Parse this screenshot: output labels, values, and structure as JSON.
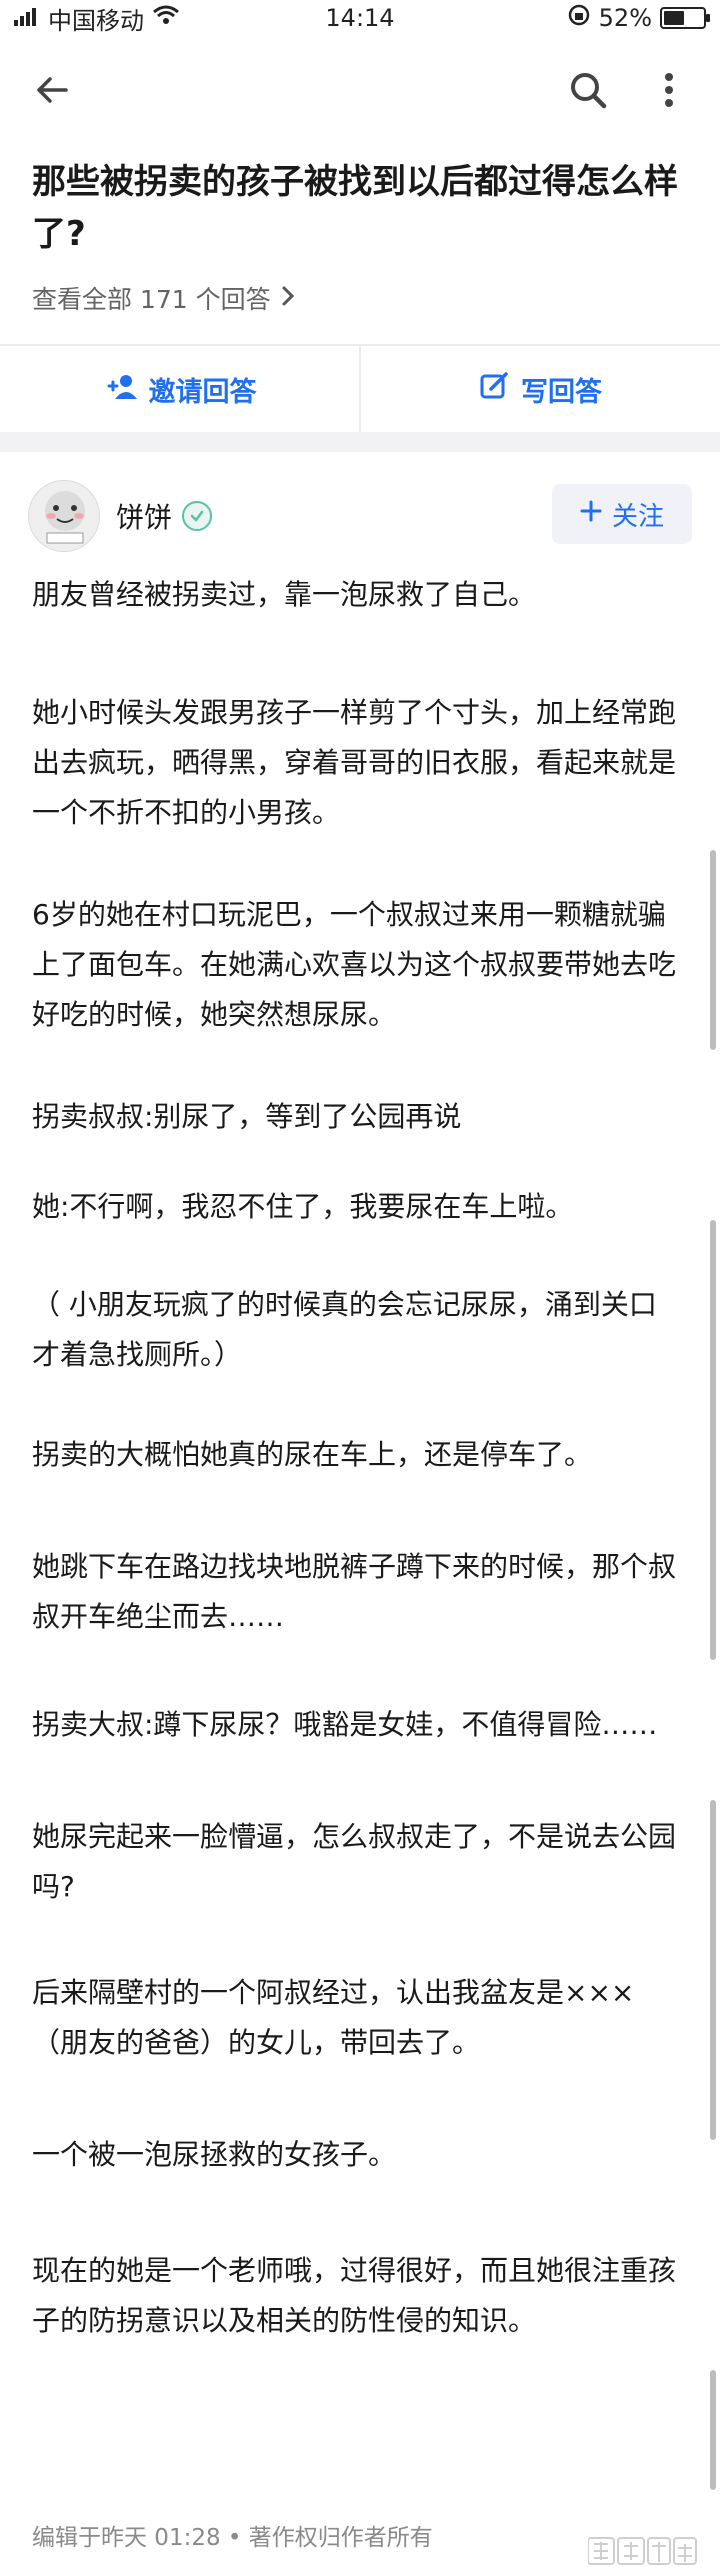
{
  "status_bar": {
    "carrier": "中国移动",
    "time": "14:14",
    "battery": "52%",
    "battery_level": 0.52
  },
  "question": {
    "title": "那些被拐卖的孩子被找到以后都过得怎么样了?",
    "all_answers": "查看全部 171 个回答"
  },
  "actions": {
    "invite": "邀请回答",
    "write": "写回答"
  },
  "author": {
    "name": "饼饼",
    "follow": "关注"
  },
  "answer": {
    "paragraphs": [
      "朋友曾经被拐卖过，靠一泡尿救了自己。",
      "她小时候头发跟男孩子一样剪了个寸头，加上经常跑出去疯玩，晒得黑，穿着哥哥的旧衣服，看起来就是一个不折不扣的小男孩。",
      "6岁的她在村口玩泥巴，一个叔叔过来用一颗糖就骗上了面包车。在她满心欢喜以为这个叔叔要带她去吃好吃的时候，她突然想尿尿。",
      "拐卖叔叔:别尿了，等到了公园再说",
      "她:不行啊，我忍不住了，我要尿在车上啦。",
      "（ 小朋友玩疯了的时候真的会忘记尿尿，涌到关口才着急找厕所。）",
      "拐卖的大概怕她真的尿在车上，还是停车了。",
      "她跳下车在路边找块地脱裤子蹲下来的时候，那个叔叔开车绝尘而去……",
      "拐卖大叔:蹲下尿尿？哦豁是女娃，不值得冒险……",
      "她尿完起来一脸懵逼，怎么叔叔走了，不是说去公园吗?",
      "后来隔壁村的一个阿叔经过，认出我盆友是×××（朋友的爸爸）的女儿，带回去了。",
      "一个被一泡尿拯救的女孩子。",
      "现在的她是一个老师哦，过得很好，而且她很注重孩子的防拐意识以及相关的防性侵的知识。"
    ],
    "footer": "编辑于昨天 01:28 • 著作权归作者所有"
  },
  "watermark_text": "搜狐新闻",
  "colors": {
    "accent": "#1f6ff0",
    "muted_text": "#8a8a8a",
    "divider": "#ececec"
  }
}
